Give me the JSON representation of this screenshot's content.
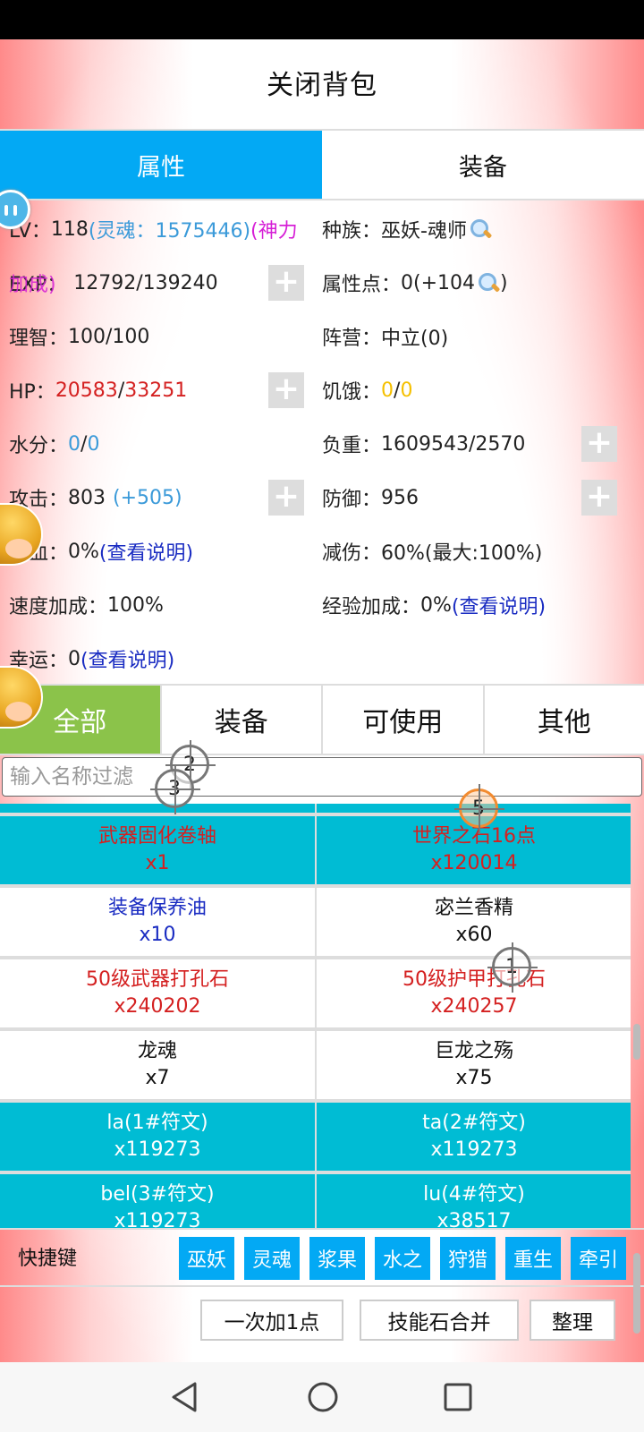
{
  "header": {
    "title": "关闭背包"
  },
  "top_tabs": [
    {
      "label": "属性",
      "active": true
    },
    {
      "label": "装备",
      "active": false
    }
  ],
  "attributes": {
    "lv": {
      "label": "LV：",
      "value": "118",
      "soul": "(灵魂：1575446)",
      "divine": "(神力"
    },
    "exp": {
      "label": "EXP：",
      "value": "12792/139240",
      "overlap": "加成)"
    },
    "race": {
      "label": "种族：",
      "value": "巫妖-魂师"
    },
    "attr_points": {
      "label": "属性点：",
      "value": "0(+104",
      "close": ")"
    },
    "reason": {
      "label": "理智：",
      "value": "100/100"
    },
    "camp": {
      "label": "阵营：",
      "value": "中立(0)"
    },
    "hp": {
      "label": "HP：",
      "current": "20583",
      "sep": "/",
      "max": "33251"
    },
    "hunger": {
      "label": "饥饿：",
      "current": "0",
      "sep": "/",
      "max": "0"
    },
    "water": {
      "label": "水分：",
      "current": "0",
      "sep": "/",
      "max": "0"
    },
    "load": {
      "label": "负重：",
      "value": "1609543/2570"
    },
    "attack": {
      "label": "攻击：",
      "value": "803",
      "bonus": "(+505)"
    },
    "defense": {
      "label": "防御：",
      "value": "956"
    },
    "lifesteal": {
      "label": "吸血：",
      "value": "0%",
      "link": "(查看说明)"
    },
    "damage_reduction": {
      "label": "减伤：",
      "value": "60%(最大:100%)"
    },
    "speed_bonus": {
      "label": "速度加成：",
      "value": "100%"
    },
    "exp_bonus": {
      "label": "经验加成：",
      "value": "0%",
      "link": "(查看说明)"
    },
    "luck": {
      "label": "幸运：",
      "value": "0",
      "link": "(查看说明)"
    },
    "plus_symbol": "+"
  },
  "category_tabs": [
    {
      "label": "全部",
      "active": true
    },
    {
      "label": "装备",
      "active": false
    },
    {
      "label": "可使用",
      "active": false
    },
    {
      "label": "其他",
      "active": false
    }
  ],
  "filter": {
    "placeholder": "输入名称过滤",
    "value": ""
  },
  "items": [
    {
      "name": "武器固化卷轴",
      "count": "x1",
      "bg": "cyan",
      "color": "#d42020"
    },
    {
      "name": "世界之石16点",
      "count": "x120014",
      "bg": "cyan",
      "color": "#d42020"
    },
    {
      "name": "装备保养油",
      "count": "x10",
      "bg": "white",
      "color": "#1a2cc2"
    },
    {
      "name": "宓兰香精",
      "count": "x60",
      "bg": "white",
      "color": "#111111"
    },
    {
      "name": "50级武器打孔石",
      "count": "x240202",
      "bg": "white",
      "color": "#d42020"
    },
    {
      "name": "50级护甲打孔石",
      "count": "x240257",
      "bg": "white",
      "color": "#d42020"
    },
    {
      "name": "龙魂",
      "count": "x7",
      "bg": "white",
      "color": "#111111"
    },
    {
      "name": "巨龙之殇",
      "count": "x75",
      "bg": "white",
      "color": "#111111"
    },
    {
      "name": "la(1#符文)",
      "count": "x119273",
      "bg": "cyan",
      "color": "#ffffff"
    },
    {
      "name": "ta(2#符文)",
      "count": "x119273",
      "bg": "cyan",
      "color": "#ffffff"
    },
    {
      "name": "bel(3#符文)",
      "count": "x119273",
      "bg": "cyan",
      "color": "#ffffff"
    },
    {
      "name": "lu(4#符文)",
      "count": "x38517",
      "bg": "cyan",
      "color": "#ffffff"
    }
  ],
  "shortcut": {
    "label": "快捷键",
    "buttons": [
      "巫妖",
      "灵魂",
      "浆果",
      "水之",
      "狩猎",
      "重生",
      "牵引"
    ]
  },
  "actions": {
    "add_one": "一次加1点",
    "merge_skill_stone": "技能石合并",
    "sort": "整理"
  },
  "markers": [
    "1",
    "2",
    "3",
    "5"
  ],
  "colors": {
    "accent_blue": "#03a9f4",
    "active_green": "#8bc34a",
    "item_cyan": "#00bcd4"
  }
}
